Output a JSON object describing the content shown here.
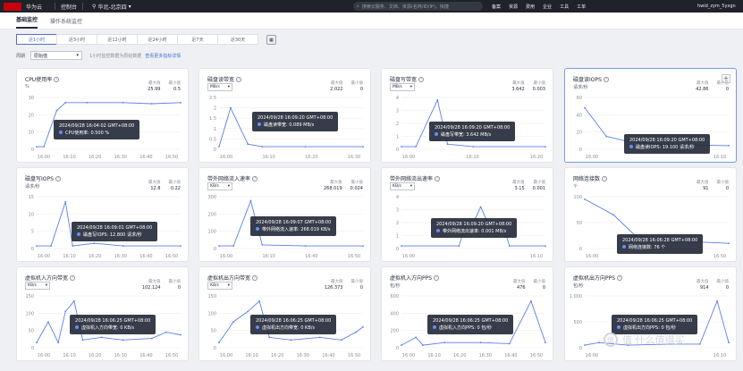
{
  "topbar": {
    "brand": "华为云",
    "console": "控制台",
    "region": "华北-北京四",
    "search_placeholder": "搜索云服务、文档、资源(名称/ID/IP)，快捷",
    "nav": [
      "备案",
      "资源",
      "费用",
      "企业",
      "工具",
      "工单"
    ],
    "user": "hwid_zym_5yxgn"
  },
  "tabs": [
    {
      "label": "基础监控",
      "active": true
    },
    {
      "label": "操作系统监控",
      "active": false
    }
  ],
  "time_range": [
    {
      "label": "近1小时",
      "active": true
    },
    {
      "label": "近3小时",
      "active": false
    },
    {
      "label": "近12小时",
      "active": false
    },
    {
      "label": "近24小时",
      "active": false
    },
    {
      "label": "近7天",
      "active": false
    },
    {
      "label": "近30天",
      "active": false
    }
  ],
  "aggregation": {
    "label": "周期",
    "value": "原始值",
    "hint": "1小时监控数据为原始数据",
    "link": "查看更多指标详情"
  },
  "watermark": "值 什么值得买",
  "cards": [
    {
      "title": "CPU使用率",
      "unit": "%",
      "max_label": "最大值",
      "min_label": "最小值",
      "max": "25.99",
      "min": "0.5",
      "yticks": [
        "30",
        "20",
        "10",
        "0"
      ],
      "xticks": [
        "16:00",
        "16:10",
        "16:20",
        "16:30",
        "16:40",
        "16:50"
      ],
      "tooltip_time": "2024/09/28 16:04:02 GMT+08:00",
      "tooltip_value": "CPU使用率: 0.500 %"
    },
    {
      "title": "磁盘读带宽",
      "unit_select": "MB/s",
      "max_label": "最大值",
      "min_label": "最小值",
      "max": "2.022",
      "min": "0",
      "yticks": [
        "2.5",
        "2",
        "1.5",
        "1",
        "0.5",
        "0"
      ],
      "xticks": [
        "16:00",
        "16:10",
        "16:20",
        "16:30"
      ],
      "tooltip_time": "2024/09/28 16:09:20 GMT+08:00",
      "tooltip_value": "磁盘读带宽: 0.089 MB/s"
    },
    {
      "title": "磁盘写带宽",
      "unit_select": "MB/s",
      "max_label": "最大值",
      "min_label": "最小值",
      "max": "3.642",
      "min": "0.003",
      "yticks": [
        "4",
        "3",
        "2",
        "1",
        "0"
      ],
      "xticks": [
        "16:00",
        "16:10",
        "16:20"
      ],
      "tooltip_time": "2024/09/28 16:09:20 GMT+08:00",
      "tooltip_value": "磁盘写带宽: 3.642 MB/s"
    },
    {
      "title": "磁盘读IOPS",
      "unit": "请求/秒",
      "max_label": "最大值",
      "min_label": "最小值",
      "max": "42.86",
      "min": "0",
      "yticks": [
        "60",
        "40",
        "20",
        "0"
      ],
      "xticks": [
        "16:00",
        "16:10"
      ],
      "tooltip_time": "2024/09/28 16:09:20 GMT+08:00",
      "tooltip_value": "磁盘读IOPS: 19.100 请求/秒"
    },
    {
      "title": "磁盘写IOPS",
      "unit": "请求/秒",
      "max_label": "最大值",
      "min_label": "最小值",
      "max": "12.8",
      "min": "0.22",
      "yticks": [
        "15",
        "10",
        "5",
        "0"
      ],
      "xticks": [
        "16:00",
        "16:10",
        "16:20",
        "16:30",
        "16:40",
        "16:50"
      ],
      "tooltip_time": "2024/09/28 16:09:01 GMT+08:00",
      "tooltip_value": "磁盘写IOPS: 12.800 请求/秒"
    },
    {
      "title": "带外网络流入速率",
      "unit_select": "KB/s",
      "max_label": "最大值",
      "min_label": "最小值",
      "max": "268.019",
      "min": "0.024",
      "yticks": [
        "300",
        "200",
        "100",
        "0"
      ],
      "xticks": [
        "16:00",
        "16:10",
        "16:40",
        "16:50"
      ],
      "tooltip_time": "2024/09/28 16:09:07 GMT+08:00",
      "tooltip_value": "带外网络流入速率: 268.019 KB/s"
    },
    {
      "title": "带外网络流出速率",
      "unit_select": "KB/s",
      "max_label": "最大值",
      "min_label": "最小值",
      "max": "3.15",
      "min": "0.001",
      "yticks": [
        "4",
        "3",
        "2",
        "1",
        "0"
      ],
      "xticks": [
        "16:00",
        "16:10"
      ],
      "tooltip_time": "2024/09/28 16:09:20 GMT+08:00",
      "tooltip_value": "带外网络流出速率: 0.001 MB/s"
    },
    {
      "title": "网络连接数",
      "unit": "个",
      "max_label": "最大值",
      "min_label": "最小值",
      "max": "91",
      "min": "0",
      "yticks": [
        "100",
        "50",
        "0"
      ],
      "xticks": [
        "16:00",
        "16:50"
      ],
      "tooltip_time": "2024/09/28 16:06:28 GMT+08:00",
      "tooltip_value": "网络连接数: 76 个"
    },
    {
      "title": "虚拟机入方向带宽",
      "unit_select": "KB/s",
      "max_label": "最大值",
      "min_label": "最小值",
      "max": "102.124",
      "min": "0",
      "yticks": [
        "150",
        "100",
        "50",
        "0"
      ],
      "xticks": [
        "16:00",
        "16:10",
        "16:20",
        "16:30",
        "16:40",
        "16:50"
      ],
      "tooltip_time": "2024/09/28 16:06:25 GMT+08:00",
      "tooltip_value": "虚拟机入方向带宽: 0 KB/s"
    },
    {
      "title": "虚拟机出方向带宽",
      "unit_select": "KB/s",
      "max_label": "最大值",
      "min_label": "最小值",
      "max": "126.373",
      "min": "0",
      "yticks": [
        "150",
        "100",
        "50",
        "0"
      ],
      "xticks": [
        "16:00",
        "16:10",
        "16:20",
        "16:30",
        "16:40",
        "16:50"
      ],
      "tooltip_time": "2024/09/28 16:06:25 GMT+08:00",
      "tooltip_value": "虚拟机出方向带宽: 0 KB/s"
    },
    {
      "title": "虚拟机入方向PPS",
      "unit": "包/秒",
      "max_label": "最大值",
      "min_label": "最小值",
      "max": "476",
      "min": "0",
      "yticks": [
        "600",
        "400",
        "200",
        "0"
      ],
      "xticks": [
        "16:00",
        "16:10",
        "16:20",
        "16:30",
        "16:40",
        "16:50"
      ],
      "tooltip_time": "2024/09/28 16:06:25 GMT+08:00",
      "tooltip_value": "虚拟机入方向PPS: 0 包/秒"
    },
    {
      "title": "虚拟机出方向PPS",
      "unit": "包/秒",
      "max_label": "最大值",
      "min_label": "最小值",
      "max": "914",
      "min": "0",
      "yticks": [
        "1,000",
        "500",
        "0"
      ],
      "xticks": [
        "16:00",
        "16:10"
      ],
      "tooltip_time": "2024/09/28 16:06:25 GMT+08:00",
      "tooltip_value": "虚拟机出方向PPS: 0 包/秒"
    }
  ]
}
